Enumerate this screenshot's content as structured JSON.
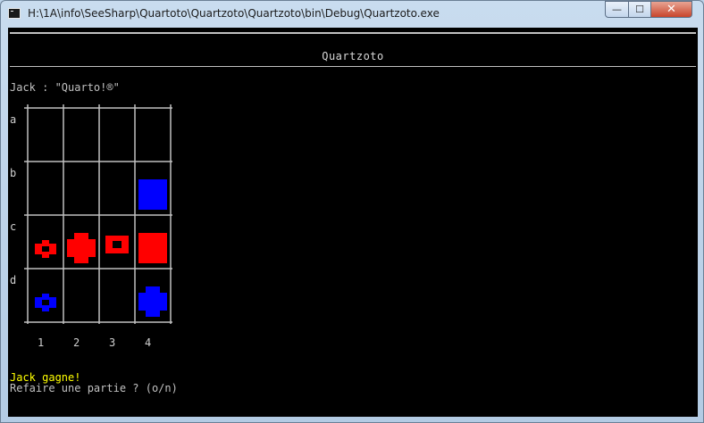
{
  "window": {
    "title": "H:\\1A\\info\\SeeSharp\\Quartoto\\Quartzoto\\Quartzoto\\bin\\Debug\\Quartzoto.exe",
    "controls": {
      "minimize": "—",
      "maximize": "☐",
      "close": "✕"
    }
  },
  "console": {
    "app_title": "Quartzoto",
    "message": "Jack : \"Quarto!®\"",
    "win_text": "Jack gagne!",
    "prompt": "Refaire une partie ? (o/n)"
  },
  "board": {
    "rows": [
      "a",
      "b",
      "c",
      "d"
    ],
    "cols": [
      "1",
      "2",
      "3",
      "4"
    ],
    "pieces": [
      {
        "row": "b",
        "col": "4",
        "color": "#0000ff",
        "shape": "square",
        "filled": true
      },
      {
        "row": "c",
        "col": "1",
        "color": "#ff0000",
        "shape": "round",
        "filled": false
      },
      {
        "row": "c",
        "col": "2",
        "color": "#ff0000",
        "shape": "round",
        "filled": true
      },
      {
        "row": "c",
        "col": "3",
        "color": "#ff0000",
        "shape": "square",
        "filled": false
      },
      {
        "row": "c",
        "col": "4",
        "color": "#ff0000",
        "shape": "square",
        "filled": true
      },
      {
        "row": "d",
        "col": "1",
        "color": "#0000ff",
        "shape": "round",
        "filled": false
      },
      {
        "row": "d",
        "col": "4",
        "color": "#0000ff",
        "shape": "round",
        "filled": true
      }
    ]
  },
  "colors": {
    "console_bg": "#000000",
    "console_text": "#c0c0c0",
    "highlight": "#ffff00"
  }
}
